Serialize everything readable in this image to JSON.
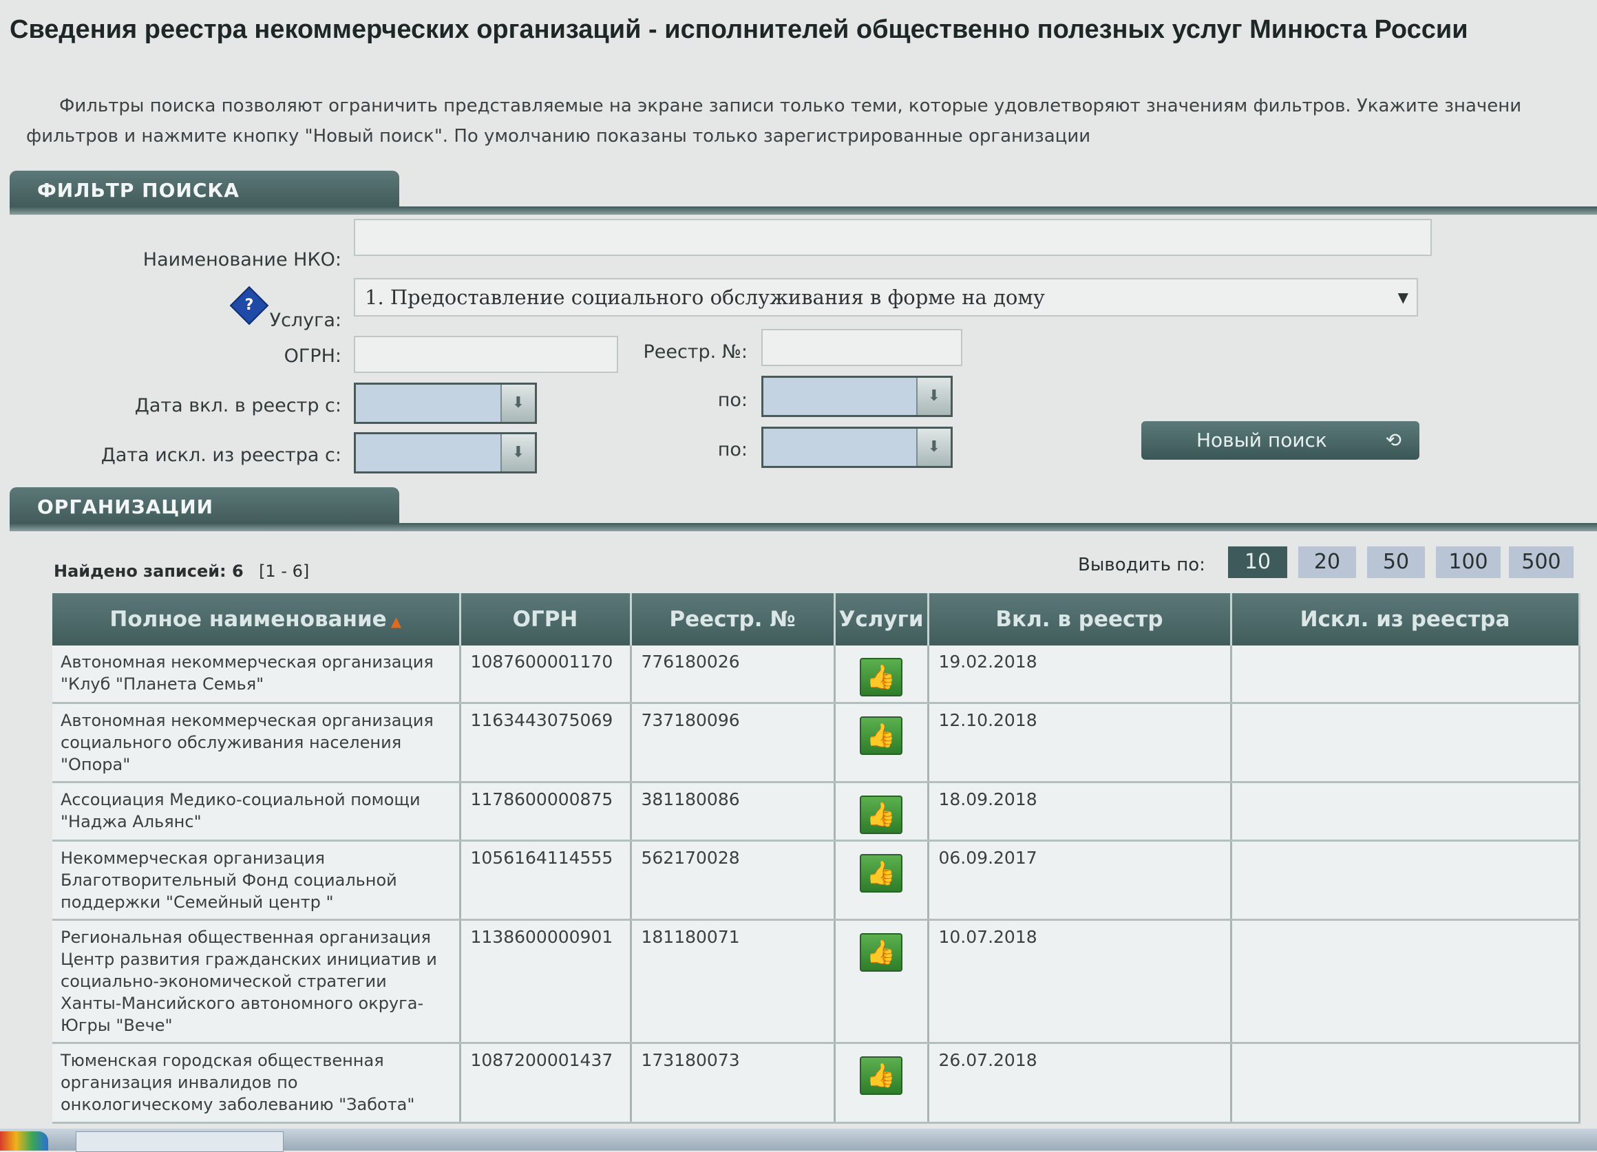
{
  "page": {
    "title": "Сведения реестра некоммерческих организаций - исполнителей общественно полезных услуг Минюста России",
    "intro_line1": "Фильтры поиска позволяют ограничить представляемые на экране записи только теми, которые удовлетворяют значениям фильтров. Укажите значени",
    "intro_line2": "фильтров и нажмите кнопку \"Новый поиск\". По умолчанию показаны только зарегистрированные организации"
  },
  "filter": {
    "section_title": "ФИЛЬТР ПОИСКА",
    "name_label": "Наименование НКО:",
    "name_value": "",
    "service_label": "Услуга:",
    "service_value": "1. Предоставление социального обслуживания в форме на дому",
    "ogrn_label": "ОГРН:",
    "ogrn_value": "",
    "reg_label": "Реестр. №:",
    "reg_value": "",
    "date_in_label": "Дата вкл. в реестр с:",
    "date_out_label": "Дата искл. из реестра с:",
    "to_label": "по:",
    "search_button": "Новый поиск",
    "help_mark": "?"
  },
  "organizations": {
    "section_title": "ОРГАНИЗАЦИИ",
    "found_label": "Найдено записей: 6",
    "range": "[1 - 6]",
    "per_page_label": "Выводить по:",
    "page_sizes": [
      "10",
      "20",
      "50",
      "100",
      "500"
    ],
    "active_page_size": "10",
    "columns": [
      "Полное наименование",
      "ОГРН",
      "Реестр. №",
      "Услуги",
      "Вкл. в реестр",
      "Искл. из реестра"
    ],
    "rows": [
      {
        "name": "Автономная некоммерческая организация \"Клуб \"Планета Семья\"",
        "ogrn": "1087600001170",
        "reg": "776180026",
        "included": "19.02.2018",
        "excluded": ""
      },
      {
        "name": "Автономная некоммерческая организация социального обслуживания населения \"Опора\"",
        "ogrn": "1163443075069",
        "reg": "737180096",
        "included": "12.10.2018",
        "excluded": ""
      },
      {
        "name": "Ассоциация Медико-социальной помощи \"Наджа Альянс\"",
        "ogrn": "1178600000875",
        "reg": "381180086",
        "included": "18.09.2018",
        "excluded": ""
      },
      {
        "name": "Некоммерческая организация Благотворительный Фонд социальной поддержки \"Семейный центр \"",
        "ogrn": "1056164114555",
        "reg": "562170028",
        "included": "06.09.2017",
        "excluded": ""
      },
      {
        "name": "Региональная общественная организация Центр развития гражданских инициатив и социально-экономической стратегии Ханты-Мансийского автономного округа-Югры \"Вече\"",
        "ogrn": "1138600000901",
        "reg": "181180071",
        "included": "10.07.2018",
        "excluded": ""
      },
      {
        "name": "Тюменская городская общественная организация инвалидов по онкологическому заболеванию \"Забота\"",
        "ogrn": "1087200001437",
        "reg": "173180073",
        "included": "26.07.2018",
        "excluded": ""
      }
    ]
  },
  "icons": {
    "services": "thumbs-up-icon",
    "date_picker": "calendar-dropdown-icon",
    "search_refresh": "refresh-icon",
    "help": "help-icon",
    "select_arrow": "chevron-down-icon"
  },
  "colors": {
    "header_bg": "#425c5c",
    "sort_arrow": "#e06a20",
    "thumb_green": "#3a9a36",
    "date_field_bg": "#c3d3e1"
  }
}
